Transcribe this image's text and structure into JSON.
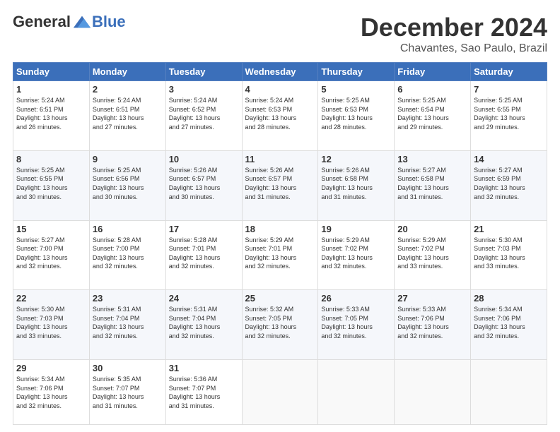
{
  "header": {
    "logo_general": "General",
    "logo_blue": "Blue",
    "main_title": "December 2024",
    "subtitle": "Chavantes, Sao Paulo, Brazil"
  },
  "columns": [
    "Sunday",
    "Monday",
    "Tuesday",
    "Wednesday",
    "Thursday",
    "Friday",
    "Saturday"
  ],
  "weeks": [
    [
      {
        "num": "1",
        "info": "Sunrise: 5:24 AM\nSunset: 6:51 PM\nDaylight: 13 hours\nand 26 minutes."
      },
      {
        "num": "2",
        "info": "Sunrise: 5:24 AM\nSunset: 6:51 PM\nDaylight: 13 hours\nand 27 minutes."
      },
      {
        "num": "3",
        "info": "Sunrise: 5:24 AM\nSunset: 6:52 PM\nDaylight: 13 hours\nand 27 minutes."
      },
      {
        "num": "4",
        "info": "Sunrise: 5:24 AM\nSunset: 6:53 PM\nDaylight: 13 hours\nand 28 minutes."
      },
      {
        "num": "5",
        "info": "Sunrise: 5:25 AM\nSunset: 6:53 PM\nDaylight: 13 hours\nand 28 minutes."
      },
      {
        "num": "6",
        "info": "Sunrise: 5:25 AM\nSunset: 6:54 PM\nDaylight: 13 hours\nand 29 minutes."
      },
      {
        "num": "7",
        "info": "Sunrise: 5:25 AM\nSunset: 6:55 PM\nDaylight: 13 hours\nand 29 minutes."
      }
    ],
    [
      {
        "num": "8",
        "info": "Sunrise: 5:25 AM\nSunset: 6:55 PM\nDaylight: 13 hours\nand 30 minutes."
      },
      {
        "num": "9",
        "info": "Sunrise: 5:25 AM\nSunset: 6:56 PM\nDaylight: 13 hours\nand 30 minutes."
      },
      {
        "num": "10",
        "info": "Sunrise: 5:26 AM\nSunset: 6:57 PM\nDaylight: 13 hours\nand 30 minutes."
      },
      {
        "num": "11",
        "info": "Sunrise: 5:26 AM\nSunset: 6:57 PM\nDaylight: 13 hours\nand 31 minutes."
      },
      {
        "num": "12",
        "info": "Sunrise: 5:26 AM\nSunset: 6:58 PM\nDaylight: 13 hours\nand 31 minutes."
      },
      {
        "num": "13",
        "info": "Sunrise: 5:27 AM\nSunset: 6:58 PM\nDaylight: 13 hours\nand 31 minutes."
      },
      {
        "num": "14",
        "info": "Sunrise: 5:27 AM\nSunset: 6:59 PM\nDaylight: 13 hours\nand 32 minutes."
      }
    ],
    [
      {
        "num": "15",
        "info": "Sunrise: 5:27 AM\nSunset: 7:00 PM\nDaylight: 13 hours\nand 32 minutes."
      },
      {
        "num": "16",
        "info": "Sunrise: 5:28 AM\nSunset: 7:00 PM\nDaylight: 13 hours\nand 32 minutes."
      },
      {
        "num": "17",
        "info": "Sunrise: 5:28 AM\nSunset: 7:01 PM\nDaylight: 13 hours\nand 32 minutes."
      },
      {
        "num": "18",
        "info": "Sunrise: 5:29 AM\nSunset: 7:01 PM\nDaylight: 13 hours\nand 32 minutes."
      },
      {
        "num": "19",
        "info": "Sunrise: 5:29 AM\nSunset: 7:02 PM\nDaylight: 13 hours\nand 32 minutes."
      },
      {
        "num": "20",
        "info": "Sunrise: 5:29 AM\nSunset: 7:02 PM\nDaylight: 13 hours\nand 33 minutes."
      },
      {
        "num": "21",
        "info": "Sunrise: 5:30 AM\nSunset: 7:03 PM\nDaylight: 13 hours\nand 33 minutes."
      }
    ],
    [
      {
        "num": "22",
        "info": "Sunrise: 5:30 AM\nSunset: 7:03 PM\nDaylight: 13 hours\nand 33 minutes."
      },
      {
        "num": "23",
        "info": "Sunrise: 5:31 AM\nSunset: 7:04 PM\nDaylight: 13 hours\nand 32 minutes."
      },
      {
        "num": "24",
        "info": "Sunrise: 5:31 AM\nSunset: 7:04 PM\nDaylight: 13 hours\nand 32 minutes."
      },
      {
        "num": "25",
        "info": "Sunrise: 5:32 AM\nSunset: 7:05 PM\nDaylight: 13 hours\nand 32 minutes."
      },
      {
        "num": "26",
        "info": "Sunrise: 5:33 AM\nSunset: 7:05 PM\nDaylight: 13 hours\nand 32 minutes."
      },
      {
        "num": "27",
        "info": "Sunrise: 5:33 AM\nSunset: 7:06 PM\nDaylight: 13 hours\nand 32 minutes."
      },
      {
        "num": "28",
        "info": "Sunrise: 5:34 AM\nSunset: 7:06 PM\nDaylight: 13 hours\nand 32 minutes."
      }
    ],
    [
      {
        "num": "29",
        "info": "Sunrise: 5:34 AM\nSunset: 7:06 PM\nDaylight: 13 hours\nand 32 minutes."
      },
      {
        "num": "30",
        "info": "Sunrise: 5:35 AM\nSunset: 7:07 PM\nDaylight: 13 hours\nand 31 minutes."
      },
      {
        "num": "31",
        "info": "Sunrise: 5:36 AM\nSunset: 7:07 PM\nDaylight: 13 hours\nand 31 minutes."
      },
      null,
      null,
      null,
      null
    ]
  ]
}
